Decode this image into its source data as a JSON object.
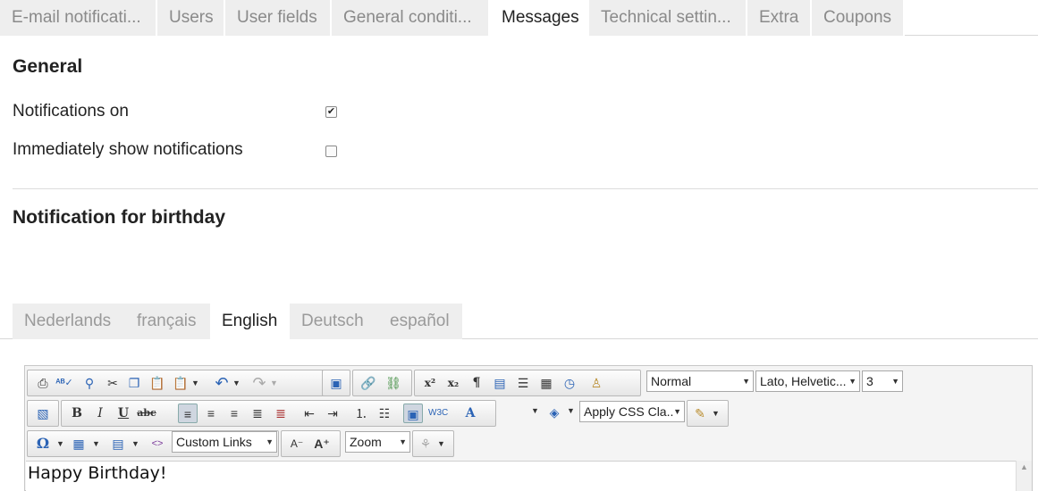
{
  "tabs": [
    "E-mail notificati...",
    "Users",
    "User fields",
    "General conditi...",
    "Messages",
    "Technical settin...",
    "Extra",
    "Coupons"
  ],
  "active_tab": "Messages",
  "general": {
    "title": "General",
    "notifications_on_label": "Notifications on",
    "notifications_on_checked": true,
    "immediately_show_label": "Immediately show notifications",
    "immediately_show_checked": false
  },
  "birthday": {
    "title": "Notification for birthday"
  },
  "language_tabs": [
    "Nederlands",
    "français",
    "English",
    "Deutsch",
    "español"
  ],
  "active_language": "English",
  "toolbar": {
    "format_select": "Normal",
    "font_select": "Lato, Helvetic...",
    "size_select": "3",
    "css_class_select": "Apply CSS Cla..",
    "custom_links_select": "Custom Links",
    "zoom_select": "Zoom"
  },
  "editor": {
    "content": "Happy Birthday!"
  },
  "colors": {
    "tab_bg": "#eeeeee",
    "border": "#d8d8d8",
    "accent_blue": "#2b63b5"
  }
}
